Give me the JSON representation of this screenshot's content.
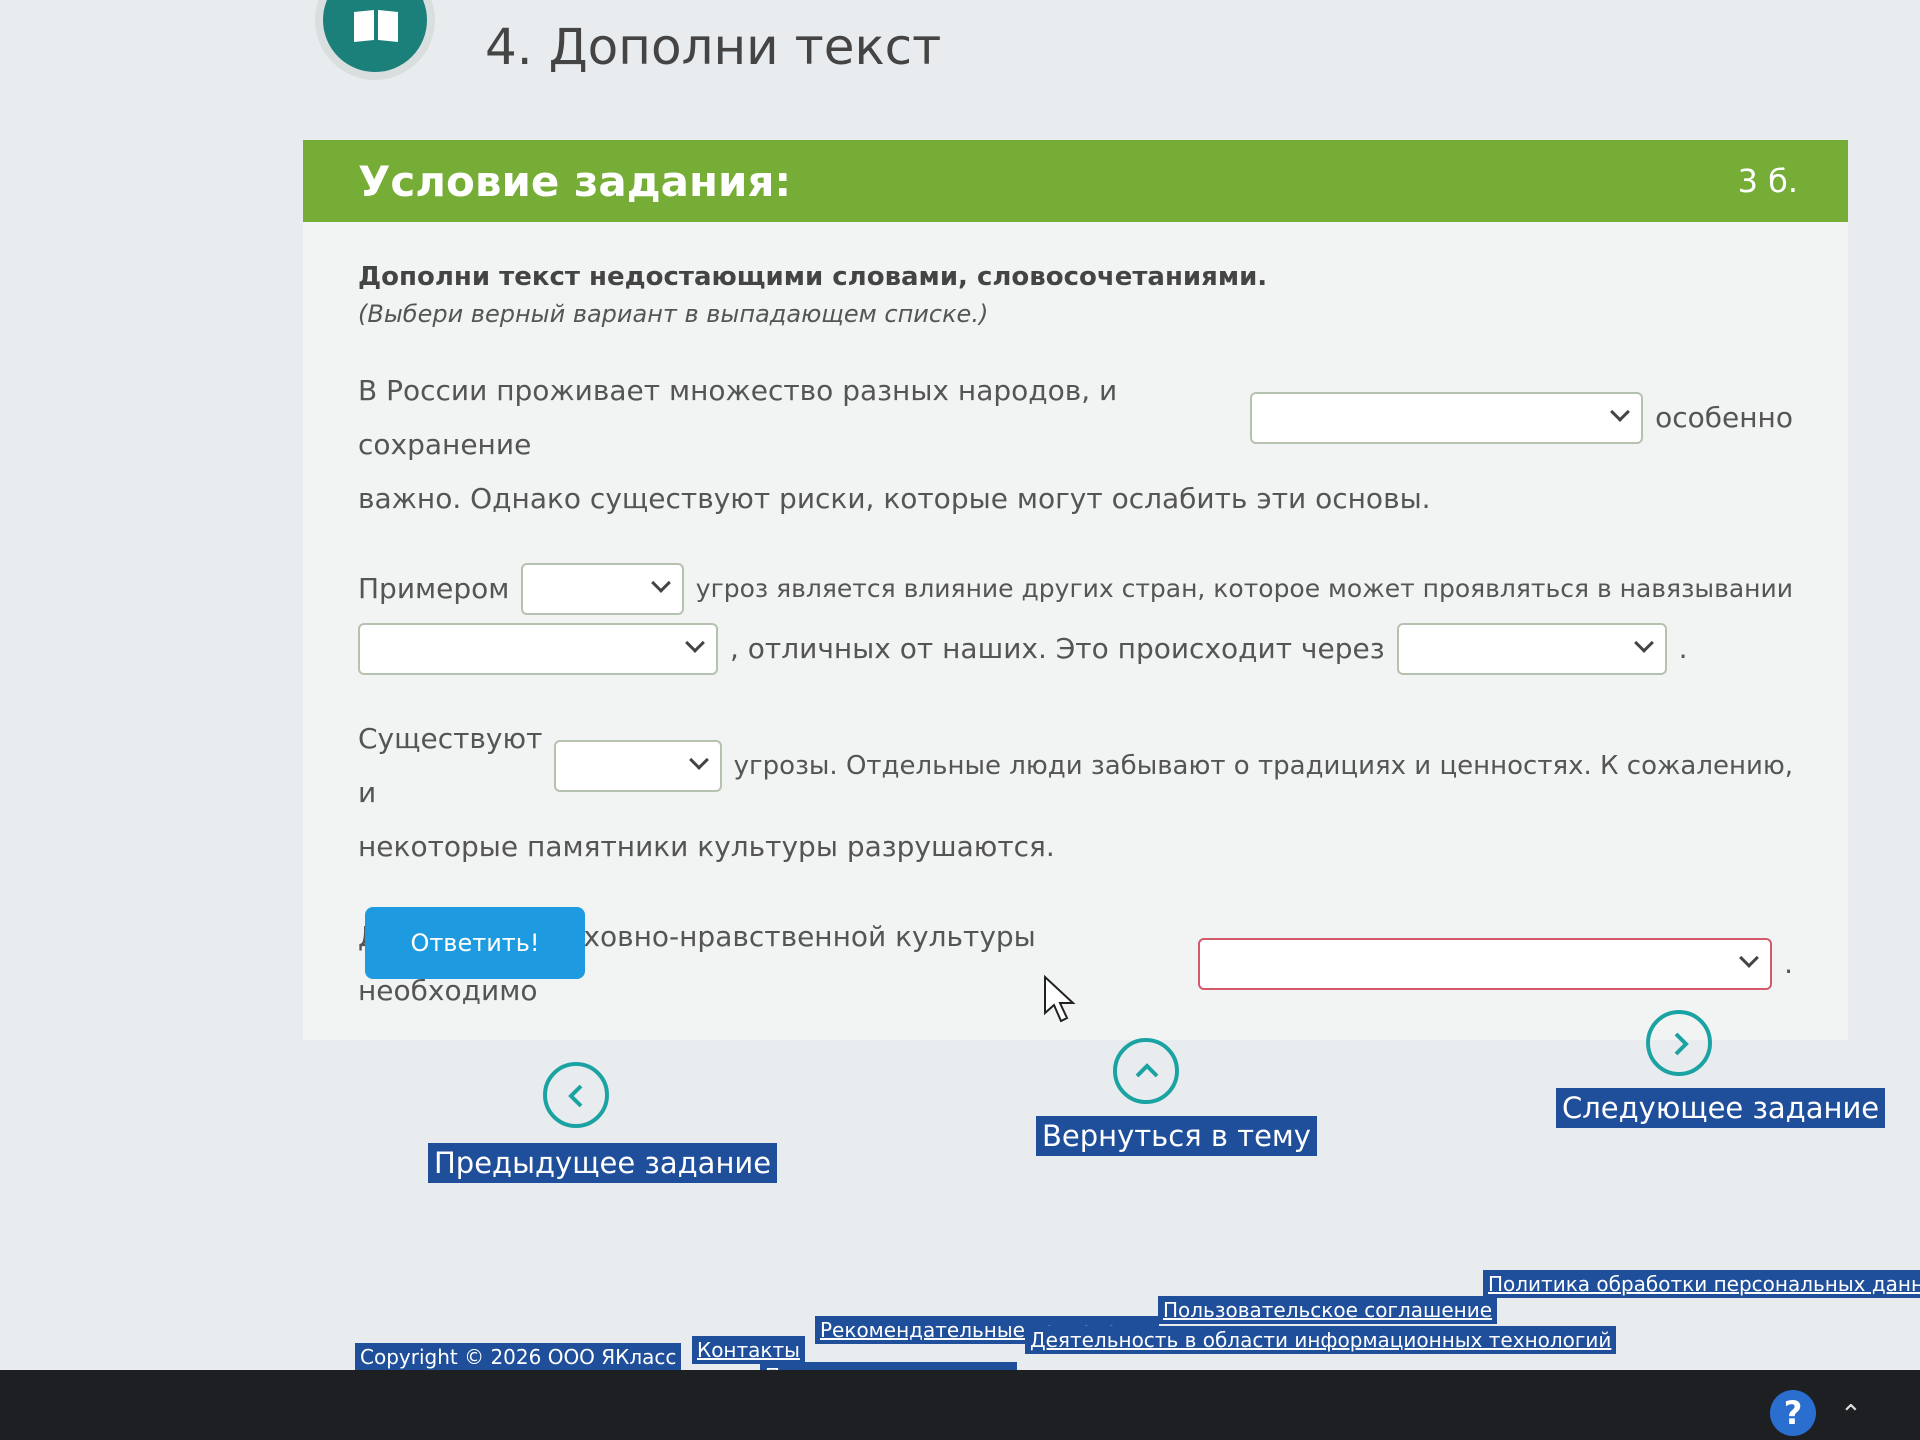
{
  "page": {
    "title": "4. Дополни текст"
  },
  "task": {
    "header_title": "Условие задания:",
    "score": "3 б.",
    "instruction_bold": "Дополни текст недостающими словами, словосочетаниями.",
    "instruction_italic": "(Выбери верный вариант в выпадающем списке.)",
    "p1": {
      "before": "В России проживает множество разных народов, и сохранение",
      "after": "особенно",
      "line2": "важно. Однако существуют риски, которые могут ослабить эти основы."
    },
    "p2": {
      "before": "Примером",
      "after": "угроз является влияние других стран, которое может проявляться в навязывании",
      "mid": ", отличных от наших. Это происходит через",
      "end": "."
    },
    "p3": {
      "before": "Существуют и",
      "after": "угрозы. Отдельные люди забывают о традициях и ценностях. К сожалению,",
      "line2": "некоторые памятники культуры разрушаются."
    },
    "p4": {
      "before": "Для защиты духовно-нравственной культуры необходимо",
      "end": "."
    },
    "answer_button": "Ответить!"
  },
  "nav": {
    "prev": "Предыдущее задание",
    "back": "Вернуться в тему",
    "next": "Следующее задание"
  },
  "footer": {
    "copyright": "Copyright © 2026 ООО ЯКласс",
    "links": [
      "Контакты",
      "Рекомендательные технологии",
      "Пользовательское соглашение",
      "Политика обработки персональных данных",
      "Политика цитирования",
      "Деятельность в области информационных технологий"
    ]
  },
  "colors": {
    "header_green": "#76ad36",
    "button_blue": "#1e9be0",
    "nav_label_bg": "#1f4f9a",
    "nav_circle": "#1ba3a3",
    "invalid_border": "#d25a6a"
  },
  "icons": [
    "book-icon",
    "chevron-left-icon",
    "chevron-up-icon",
    "chevron-right-icon",
    "help-icon",
    "chevron-down-icon"
  ]
}
